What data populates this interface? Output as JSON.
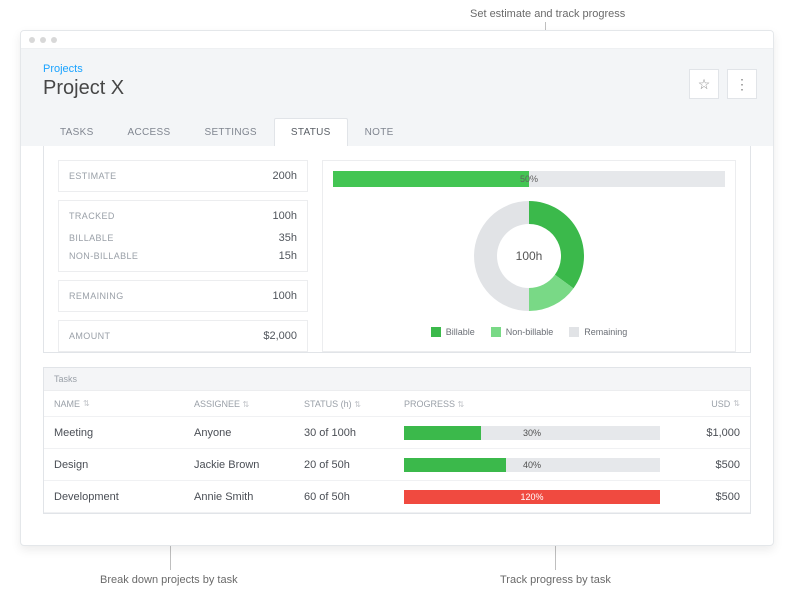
{
  "annotations": {
    "top": "Set estimate and track progress",
    "bottom_left": "Break down projects by task",
    "bottom_right": "Track progress by task"
  },
  "breadcrumb": "Projects",
  "title": "Project X",
  "tabs": {
    "t0": "TASKS",
    "t1": "ACCESS",
    "t2": "SETTINGS",
    "t3": "STATUS",
    "t4": "NOTE"
  },
  "stats": {
    "estimate_label": "ESTIMATE",
    "estimate_value": "200h",
    "tracked_label": "TRACKED",
    "tracked_value": "100h",
    "billable_label": "BILLABLE",
    "billable_value": "35h",
    "nonbillable_label": "NON-BILLABLE",
    "nonbillable_value": "15h",
    "remaining_label": "REMAINING",
    "remaining_value": "100h",
    "amount_label": "AMOUNT",
    "amount_value": "$2,000"
  },
  "progress_bar": {
    "percent": 50,
    "label": "50%"
  },
  "donut": {
    "center": "100h",
    "billable_pct": 35,
    "nonbillable_pct": 15,
    "remaining_pct": 50
  },
  "legend": {
    "billable": "Billable",
    "nonbillable": "Non-billable",
    "remaining": "Remaining"
  },
  "colors": {
    "billable": "#3bb94b",
    "nonbillable": "#79d986",
    "remaining": "#e1e3e6",
    "over": "#f04a40"
  },
  "tasks_header": "Tasks",
  "columns": {
    "name": "NAME",
    "assignee": "ASSIGNEE",
    "status": "STATUS (h)",
    "progress": "PROGRESS",
    "usd": "USD"
  },
  "tasks": [
    {
      "name": "Meeting",
      "assignee": "Anyone",
      "status": "30 of 100h",
      "progress_pct": 30,
      "progress_label": "30%",
      "over": false,
      "usd": "$1,000"
    },
    {
      "name": "Design",
      "assignee": "Jackie Brown",
      "status": "20 of 50h",
      "progress_pct": 40,
      "progress_label": "40%",
      "over": false,
      "usd": "$500"
    },
    {
      "name": "Development",
      "assignee": "Annie Smith",
      "status": "60 of 50h",
      "progress_pct": 120,
      "progress_label": "120%",
      "over": true,
      "usd": "$500"
    }
  ],
  "chart_data": {
    "type": "pie",
    "title": "Tracked hours breakdown",
    "series": [
      {
        "name": "Billable",
        "value": 35,
        "color": "#3bb94b"
      },
      {
        "name": "Non-billable",
        "value": 15,
        "color": "#79d986"
      },
      {
        "name": "Remaining",
        "value": 100,
        "color": "#e1e3e6"
      }
    ],
    "center_label": "100h",
    "overall_progress_pct": 50
  }
}
